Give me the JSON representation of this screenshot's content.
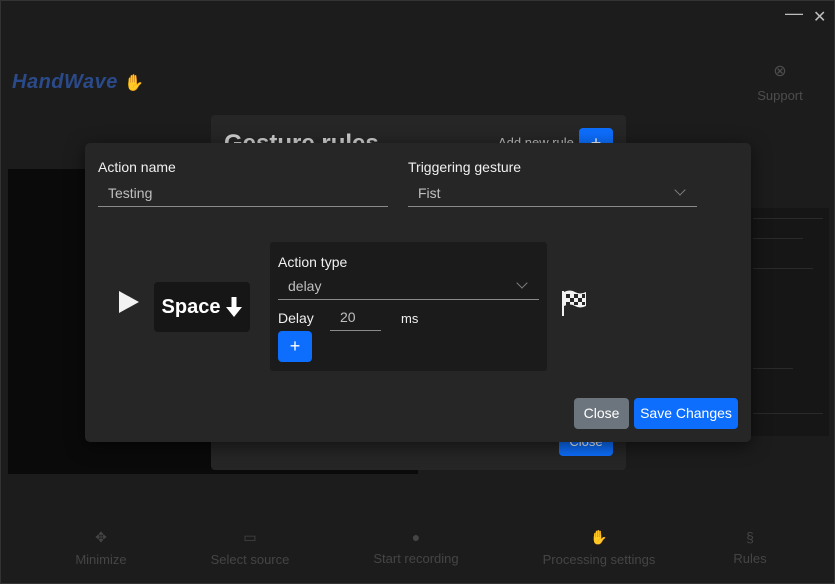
{
  "window": {
    "minimize_glyph": "—",
    "close_glyph": "✕"
  },
  "app": {
    "brand": "HandWave",
    "support_label": "Support",
    "bottom_bar": [
      {
        "label": "Minimize",
        "icon": "minimize-icon"
      },
      {
        "label": "Select source",
        "icon": "monitor-icon"
      },
      {
        "label": "Start recording",
        "icon": "record-icon"
      },
      {
        "label": "Processing settings",
        "icon": "hand-icon"
      },
      {
        "label": "Rules",
        "icon": "section-icon"
      }
    ]
  },
  "rules_modal": {
    "title": "Gesture rules",
    "add_label": "Add new rule",
    "add_button": "+",
    "close_button": "Close"
  },
  "action_modal": {
    "action_name_label": "Action name",
    "action_name_value": "Testing",
    "trigger_label": "Triggering gesture",
    "trigger_value": "Fist",
    "key_chip": "Space",
    "action_type_label": "Action type",
    "action_type_value": "delay",
    "delay_label": "Delay",
    "delay_value": "20",
    "delay_unit": "ms",
    "plus_button": "+",
    "close_button": "Close",
    "save_button": "Save Changes"
  },
  "colors": {
    "primary": "#0d6efd",
    "secondary": "#6c757d",
    "modal_bg": "#262626",
    "panel_bg": "#1b1b1b"
  }
}
